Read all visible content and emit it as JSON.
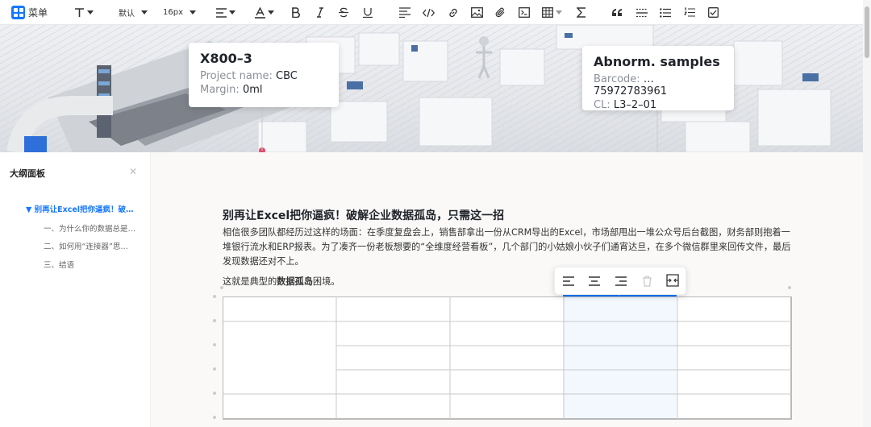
{
  "toolbar": {
    "menu_label": "菜单",
    "font_family": "默认",
    "font_size": "16px"
  },
  "hero": {
    "card1": {
      "title": "X800–3",
      "project_label": "Project name:",
      "project_value": "CBC",
      "margin_label": "Margin:",
      "margin_value": "0ml"
    },
    "card2": {
      "title": "Abnorm. samples",
      "barcode_label": "Barcode:",
      "barcode_value": "…75972783961",
      "cl_label": "CL:",
      "cl_value": "L3–2–01"
    }
  },
  "sidebar": {
    "title": "大纲面板",
    "items": [
      {
        "label": "▼ 别再让Excel把你逼疯！破…"
      },
      {
        "label": "一、为什么你的数据总是…"
      },
      {
        "label": "二、如何用“连接器”思…"
      },
      {
        "label": "三、结语"
      }
    ]
  },
  "doc": {
    "heading": "别再让Excel把你逼疯！破解企业数据孤岛，只需这一招",
    "paragraph": "相信很多团队都经历过这样的场面：在季度复盘会上，销售部拿出一份从CRM导出的Excel，市场部甩出一堆公众号后台截图，财务部则抱着一堆银行流水和ERP报表。为了凑齐一份老板想要的“全维度经营看板”，几个部门的小姑娘小伙子们通宵达旦，在多个微信群里来回传文件，最后发现数据还对不上。",
    "p2_prefix": "这就是典型的",
    "p2_bold": "数据孤岛",
    "p2_suffix": "困境。"
  },
  "colors": {
    "accent": "#1677ff"
  }
}
